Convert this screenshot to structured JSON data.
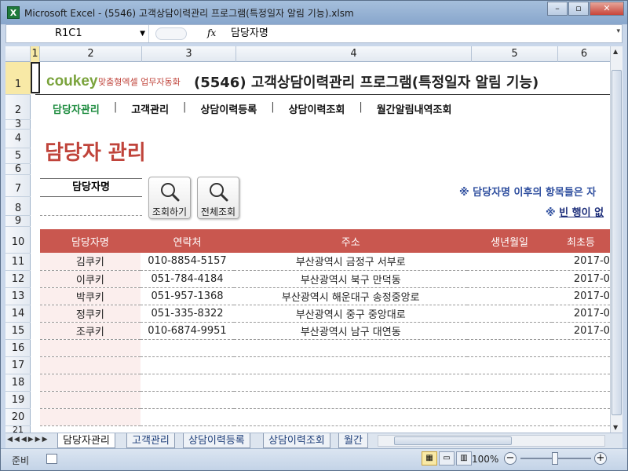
{
  "window": {
    "title": "Microsoft Excel - (5546) 고객상담이력관리 프로그램(특정일자 알림 기능).xlsm",
    "app_icon": "X",
    "buttons": {
      "minimize": "–",
      "restore": "▫",
      "close": "✕"
    }
  },
  "formula_bar": {
    "name_box": "R1C1",
    "fx_label": "fx",
    "content": "담당자명"
  },
  "columns": [
    "1",
    "2",
    "3",
    "4",
    "5",
    "6"
  ],
  "rows": [
    "1",
    "2",
    "3",
    "4",
    "5",
    "6",
    "7",
    "8",
    "9",
    "10",
    "11",
    "12",
    "13",
    "14",
    "15",
    "16",
    "17",
    "18",
    "19",
    "20",
    "21"
  ],
  "header": {
    "logo_main": "coukey",
    "logo_sub": "맞춤형엑셀 업무자동화",
    "program_title": "(5546) 고객상담이력관리 프로그램(특정일자 알림 기능)"
  },
  "nav": {
    "items": [
      {
        "label": "담당자관리",
        "active": true
      },
      {
        "label": "고객관리",
        "active": false
      },
      {
        "label": "상담이력등록",
        "active": false
      },
      {
        "label": "상담이력조회",
        "active": false
      },
      {
        "label": "월간알림내역조회",
        "active": false
      }
    ],
    "separator": "|"
  },
  "page": {
    "heading": "담당자 관리",
    "search_label": "담당자명",
    "search_value": "",
    "btn_search": "조회하기",
    "btn_all": "전체조회",
    "notice1": "※ 담당자명 이후의 항목들은 자",
    "notice2_prefix": "※ ",
    "notice2_link": "빈 행이 없"
  },
  "table": {
    "columns": [
      "담당자명",
      "연락처",
      "주소",
      "생년월일",
      "최초등"
    ],
    "rows": [
      {
        "name": "김쿠키",
        "phone": "010-8854-5157",
        "address": "부산광역시 금정구 서부로",
        "birth": "",
        "first": "2017-0"
      },
      {
        "name": "이쿠키",
        "phone": "051-784-4184",
        "address": "부산광역시 북구 만덕동",
        "birth": "",
        "first": "2017-0"
      },
      {
        "name": "박쿠키",
        "phone": "051-957-1368",
        "address": "부산광역시 해운대구 송정중앙로",
        "birth": "",
        "first": "2017-0"
      },
      {
        "name": "정쿠키",
        "phone": "051-335-8322",
        "address": "부산광역시 중구 중앙대로",
        "birth": "",
        "first": "2017-0"
      },
      {
        "name": "조쿠키",
        "phone": "010-6874-9951",
        "address": "부산광역시 남구 대연동",
        "birth": "",
        "first": "2017-0"
      },
      {
        "name": "",
        "phone": "",
        "address": "",
        "birth": "",
        "first": ""
      },
      {
        "name": "",
        "phone": "",
        "address": "",
        "birth": "",
        "first": ""
      },
      {
        "name": "",
        "phone": "",
        "address": "",
        "birth": "",
        "first": ""
      },
      {
        "name": "",
        "phone": "",
        "address": "",
        "birth": "",
        "first": ""
      },
      {
        "name": "",
        "phone": "",
        "address": "",
        "birth": "",
        "first": ""
      }
    ]
  },
  "sheet_tabs": [
    "담당자관리",
    "고객관리",
    "상담이력등록",
    "상담이력조회",
    "월간"
  ],
  "active_tab": 0,
  "status": {
    "ready": "준비",
    "zoom": "100%"
  },
  "colors": {
    "accent_red": "#c0443b",
    "header_red": "#c9574f",
    "nav_active": "#1a8a3c",
    "notice_blue": "#2f4f9f"
  }
}
